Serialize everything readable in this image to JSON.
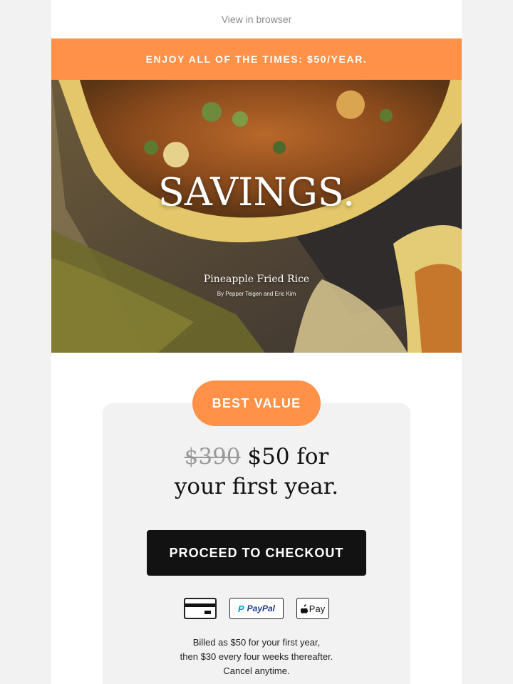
{
  "header": {
    "view_in_browser": "View in browser"
  },
  "promo_banner": {
    "text": "ENJOY ALL OF THE TIMES: $50/YEAR."
  },
  "hero": {
    "headline": "SAVINGS.",
    "recipe_title": "Pineapple Fried Rice",
    "recipe_byline": "By Pepper Teigen and Eric Kim"
  },
  "offer": {
    "badge": "BEST VALUE",
    "old_price": "$390",
    "new_price_line1": "$50 for",
    "new_price_line2": "your first year.",
    "cta_label": "PROCEED TO CHECKOUT",
    "payment_methods": {
      "card": "credit-card-icon",
      "paypal": "PayPal",
      "apple": "Pay"
    },
    "billing_line1": "Billed as $50 for your first year,",
    "billing_line2": "then $30 every four weeks thereafter.",
    "billing_line3": "Cancel anytime."
  },
  "colors": {
    "accent_orange": "#ff9248",
    "cta_black": "#121212",
    "card_gray": "#f2f2f2"
  }
}
